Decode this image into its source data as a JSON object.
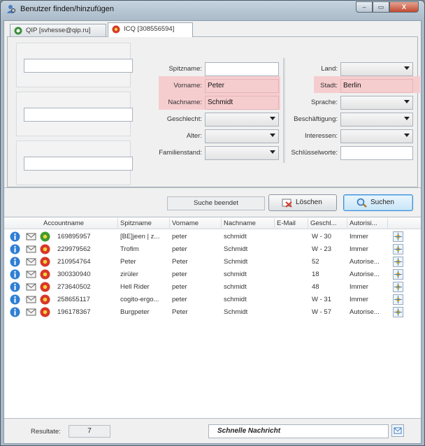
{
  "window": {
    "title": "Benutzer finden/hinzufügen",
    "controls": {
      "minimize": "–",
      "maximize": "▭",
      "close": "X"
    }
  },
  "tabs": [
    {
      "label": "QIP [svhesse@qip.ru]",
      "active": false
    },
    {
      "label": "ICQ [308556594]",
      "active": true
    }
  ],
  "form": {
    "spitzname": {
      "label": "Spitzname:",
      "value": ""
    },
    "vorname": {
      "label": "Vorname:",
      "value": "Peter"
    },
    "nachname": {
      "label": "Nachname:",
      "value": "Schmidt"
    },
    "geschlecht": {
      "label": "Geschlecht:",
      "value": ""
    },
    "alter": {
      "label": "Alter:",
      "value": ""
    },
    "familienstand": {
      "label": "Familienstand:",
      "value": ""
    },
    "land": {
      "label": "Land:",
      "value": ""
    },
    "stadt": {
      "label": "Stadt:",
      "value": "Berlin"
    },
    "sprache": {
      "label": "Sprache:",
      "value": ""
    },
    "beschaeftigung": {
      "label": "Beschäftigung:",
      "value": ""
    },
    "interessen": {
      "label": "Interessen:",
      "value": ""
    },
    "schluesselworte": {
      "label": "Schlüsselworte:",
      "value": ""
    },
    "highlight_color": "#f6cdcf"
  },
  "actions": {
    "status": "Suche beendet",
    "clear_label": "Löschen",
    "search_label": "Suchen"
  },
  "results": {
    "columns": [
      "Accountname",
      "Spitzname",
      "Vorname",
      "Nachname",
      "E-Mail",
      "Geschl...",
      "Autorisi..."
    ],
    "rows": [
      {
        "account": "169895957",
        "nick": "[BE]jeen | z...",
        "first": "peter",
        "last": "schmidt",
        "email": "",
        "gender_age": "W - 30",
        "auth": "Immer",
        "status_icon": "online-flower-icon"
      },
      {
        "account": "229979562",
        "nick": "Trofim",
        "first": "peter",
        "last": "Schmidt",
        "email": "",
        "gender_age": "W - 23",
        "auth": "Immer",
        "status_icon": "offline-flower-icon"
      },
      {
        "account": "210954764",
        "nick": "Peter",
        "first": "Peter",
        "last": "Schmidt",
        "email": "",
        "gender_age": "52",
        "auth": "Autorise...",
        "status_icon": "offline-flower-icon"
      },
      {
        "account": "300330940",
        "nick": "zirüler",
        "first": "peter",
        "last": "schmidt",
        "email": "",
        "gender_age": "18",
        "auth": "Autorise...",
        "status_icon": "offline-flower-icon"
      },
      {
        "account": "273640502",
        "nick": "Hell Rider",
        "first": "peter",
        "last": "schmidt",
        "email": "",
        "gender_age": "48",
        "auth": "Immer",
        "status_icon": "offline-flower-icon"
      },
      {
        "account": "258655117",
        "nick": "cogito-ergo...",
        "first": "peter",
        "last": "schmidt",
        "email": "",
        "gender_age": "W - 31",
        "auth": "Immer",
        "status_icon": "offline-flower-icon"
      },
      {
        "account": "196178367",
        "nick": "Burgpeter",
        "first": "Peter",
        "last": "Schmidt",
        "email": "",
        "gender_age": "W - 57",
        "auth": "Autorise...",
        "status_icon": "offline-flower-icon"
      }
    ]
  },
  "footer": {
    "results_label": "Resultate:",
    "results_count": "7",
    "quick_message": "Schnelle Nachricht"
  }
}
